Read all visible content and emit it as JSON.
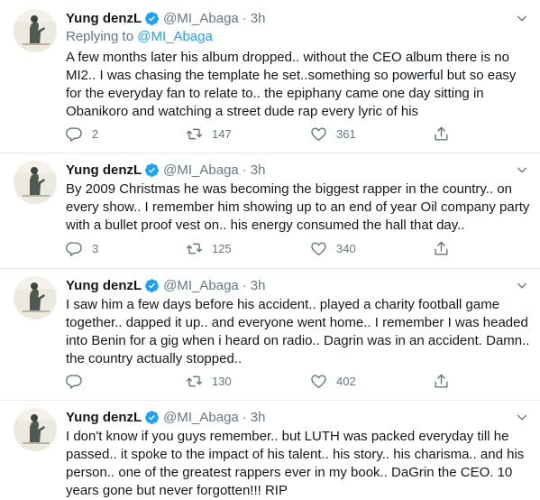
{
  "colors": {
    "accent": "#1da1f2",
    "muted": "#657786",
    "text": "#14171a",
    "divider": "#e6ecf0"
  },
  "icons": {
    "verified": "verified-badge-icon",
    "caret": "chevron-down-icon",
    "reply": "reply-icon",
    "retweet": "retweet-icon",
    "like": "heart-icon",
    "share": "share-icon"
  },
  "tweets": [
    {
      "name": "Yung denzL",
      "handle": "@MI_Abaga",
      "sep": "·",
      "time": "3h",
      "replying_prefix": "Replying to ",
      "replying_to": "@MI_Abaga",
      "text": "A few months later his album dropped.. without the CEO album there is no MI2.. I was chasing the template he set..something so powerful but so easy for the everyday fan to relate to.. the epiphany came one day sitting in Obanikoro and watching a street dude rap every lyric of his",
      "replies": "2",
      "retweets": "147",
      "likes": "361"
    },
    {
      "name": "Yung denzL",
      "handle": "@MI_Abaga",
      "sep": "·",
      "time": "3h",
      "text": "By 2009 Christmas he was becoming the biggest rapper in the country.. on every show.. I remember him showing up to an end of year Oil company party with a bullet proof vest on.. his energy consumed the hall that day..",
      "replies": "3",
      "retweets": "125",
      "likes": "340"
    },
    {
      "name": "Yung denzL",
      "handle": "@MI_Abaga",
      "sep": "·",
      "time": "3h",
      "text": "I saw him a few days before his accident.. played a charity football game together.. dapped it up.. and everyone went home.. I remember I was headed into Benin for a gig when i heard on radio.. Dagrin was in an accident. Damn.. the country actually stopped..",
      "replies": "",
      "retweets": "130",
      "likes": "402"
    },
    {
      "name": "Yung denzL",
      "handle": "@MI_Abaga",
      "sep": "·",
      "time": "3h",
      "text": "I don't know if you guys remember.. but LUTH was packed everyday till he passed.. it spoke to the impact of his talent.. his story.. his charisma.. and his person.. one of the greatest rappers ever in my book.. DaGrin the CEO. 10 years gone but never forgotten!!! RIP"
    }
  ]
}
